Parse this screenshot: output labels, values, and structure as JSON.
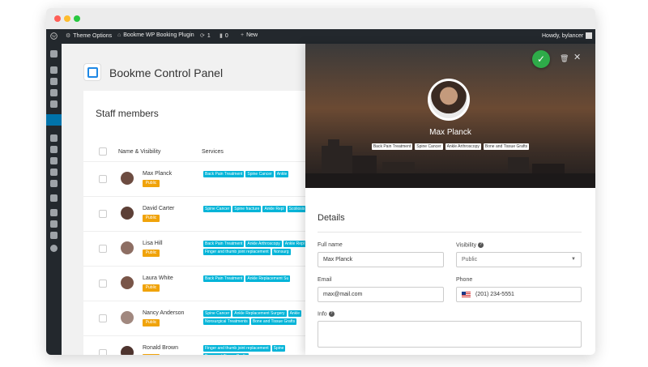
{
  "admin_bar": {
    "theme_options": "Theme Options",
    "site_name": "Bookme WP Booking Plugin",
    "updates_count": "1",
    "comments_count": "0",
    "new_label": "New",
    "greeting": "Howdy, bylancer"
  },
  "page": {
    "title": "Bookme Control Panel"
  },
  "staff_panel": {
    "title": "Staff members",
    "columns": [
      "Name & Visibility",
      "Services"
    ],
    "rows": [
      {
        "name": "Max Planck",
        "visibility": "Public",
        "services": [
          "Back Pain Treatment",
          "Spine Cancer",
          "Ankle"
        ]
      },
      {
        "name": "David Carter",
        "visibility": "Public",
        "services": [
          "Spine Cancer",
          "Spine fracture",
          "Ankle Repl",
          "Scoliosis Treatment"
        ]
      },
      {
        "name": "Lisa Hill",
        "visibility": "Public",
        "services": [
          "Back Pain Treatment",
          "Ankle Arthroscopy",
          "Ankle Repl",
          "Finger and thumb joint replacement",
          "Nonsurg"
        ]
      },
      {
        "name": "Laura White",
        "visibility": "Public",
        "services": [
          "Back Pain Treatment",
          "Ankle Replacement Su"
        ]
      },
      {
        "name": "Nancy Anderson",
        "visibility": "Public",
        "services": [
          "Spine Cancer",
          "Ankle Replacement Surgery",
          "Ankle",
          "Nonsurgical Treatments",
          "Bone and Tissue Grafts"
        ]
      },
      {
        "name": "Ronald Brown",
        "visibility": "Public",
        "services": [
          "Finger and thumb joint replacement",
          "Spine",
          "Bone and Tissue Grafts"
        ]
      }
    ]
  },
  "drawer": {
    "name": "Max Planck",
    "tags": [
      "Back Pain Treatment",
      "Spine Cancer",
      "Ankle Arthroscopy",
      "Bone and Tissue Grafts"
    ],
    "details_title": "Details",
    "fields": {
      "full_name": {
        "label": "Full name",
        "value": "Max Planck"
      },
      "visibility": {
        "label": "Visibility",
        "value": "Public"
      },
      "email": {
        "label": "Email",
        "value": "max@mail.com"
      },
      "phone": {
        "label": "Phone",
        "value": "(201) 234-5551"
      },
      "info": {
        "label": "Info",
        "value": ""
      }
    }
  },
  "colors": {
    "accent": "#0073aa",
    "service_tag": "#00b4d8",
    "badge": "#f0a30a",
    "save": "#2eab49",
    "admin_bar": "#23282d"
  }
}
